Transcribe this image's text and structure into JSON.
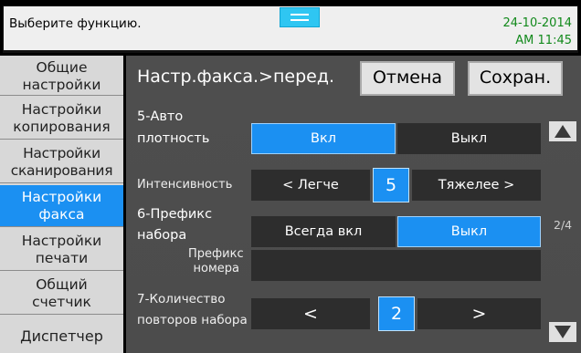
{
  "status": {
    "prompt": "Выберите функцию.",
    "date": "24-10-2014",
    "time": "AM 11:45",
    "menu_icon": "menu-lines-icon"
  },
  "sidebar": {
    "items": [
      {
        "label": "Общие настройки",
        "line1": "Общие",
        "line2": "настройки",
        "active": false
      },
      {
        "label": "Настройки копирования",
        "line1": "Настройки",
        "line2": "копирования",
        "active": false
      },
      {
        "label": "Настройки сканирования",
        "line1": "Настройки",
        "line2": "сканирования",
        "active": false
      },
      {
        "label": "Настройки факса",
        "line1": "Настройки",
        "line2": "факса",
        "active": true
      },
      {
        "label": "Настройки печати",
        "line1": "Настройки",
        "line2": "печати",
        "active": false
      },
      {
        "label": "Общий счетчик",
        "line1": "Общий",
        "line2": "счетчик",
        "active": false
      },
      {
        "label": "Диспетчер",
        "line1": "Диспетчер",
        "line2": "",
        "active": false
      }
    ]
  },
  "header": {
    "title": "Настр.факса.>перед.",
    "cancel_label": "Отмена",
    "save_label": "Сохран."
  },
  "settings": {
    "auto_density": {
      "label_line1": "5-Авто",
      "label_line2": "плотность",
      "on_label": "Вкл",
      "off_label": "Выкл",
      "selected": "on"
    },
    "intensity": {
      "label": "Интенсивность",
      "lighter_label": "< Легче",
      "value": "5",
      "darker_label": "Тяжелее >"
    },
    "dial_prefix": {
      "label_line1": "6-Префикс",
      "label_line2": "набора",
      "always_on_label": "Всегда вкл",
      "off_label": "Выкл",
      "selected": "off"
    },
    "prefix_number": {
      "label_line1": "Префикс",
      "label_line2": "номера",
      "value": ""
    },
    "redial_count": {
      "label_line1": "7-Количество",
      "label_line2": "повторов набора",
      "decrease_label": "<",
      "value": "2",
      "increase_label": ">"
    }
  },
  "pagination": {
    "indicator": "2/4",
    "up_icon": "triangle-up-icon",
    "down_icon": "triangle-down-icon"
  }
}
